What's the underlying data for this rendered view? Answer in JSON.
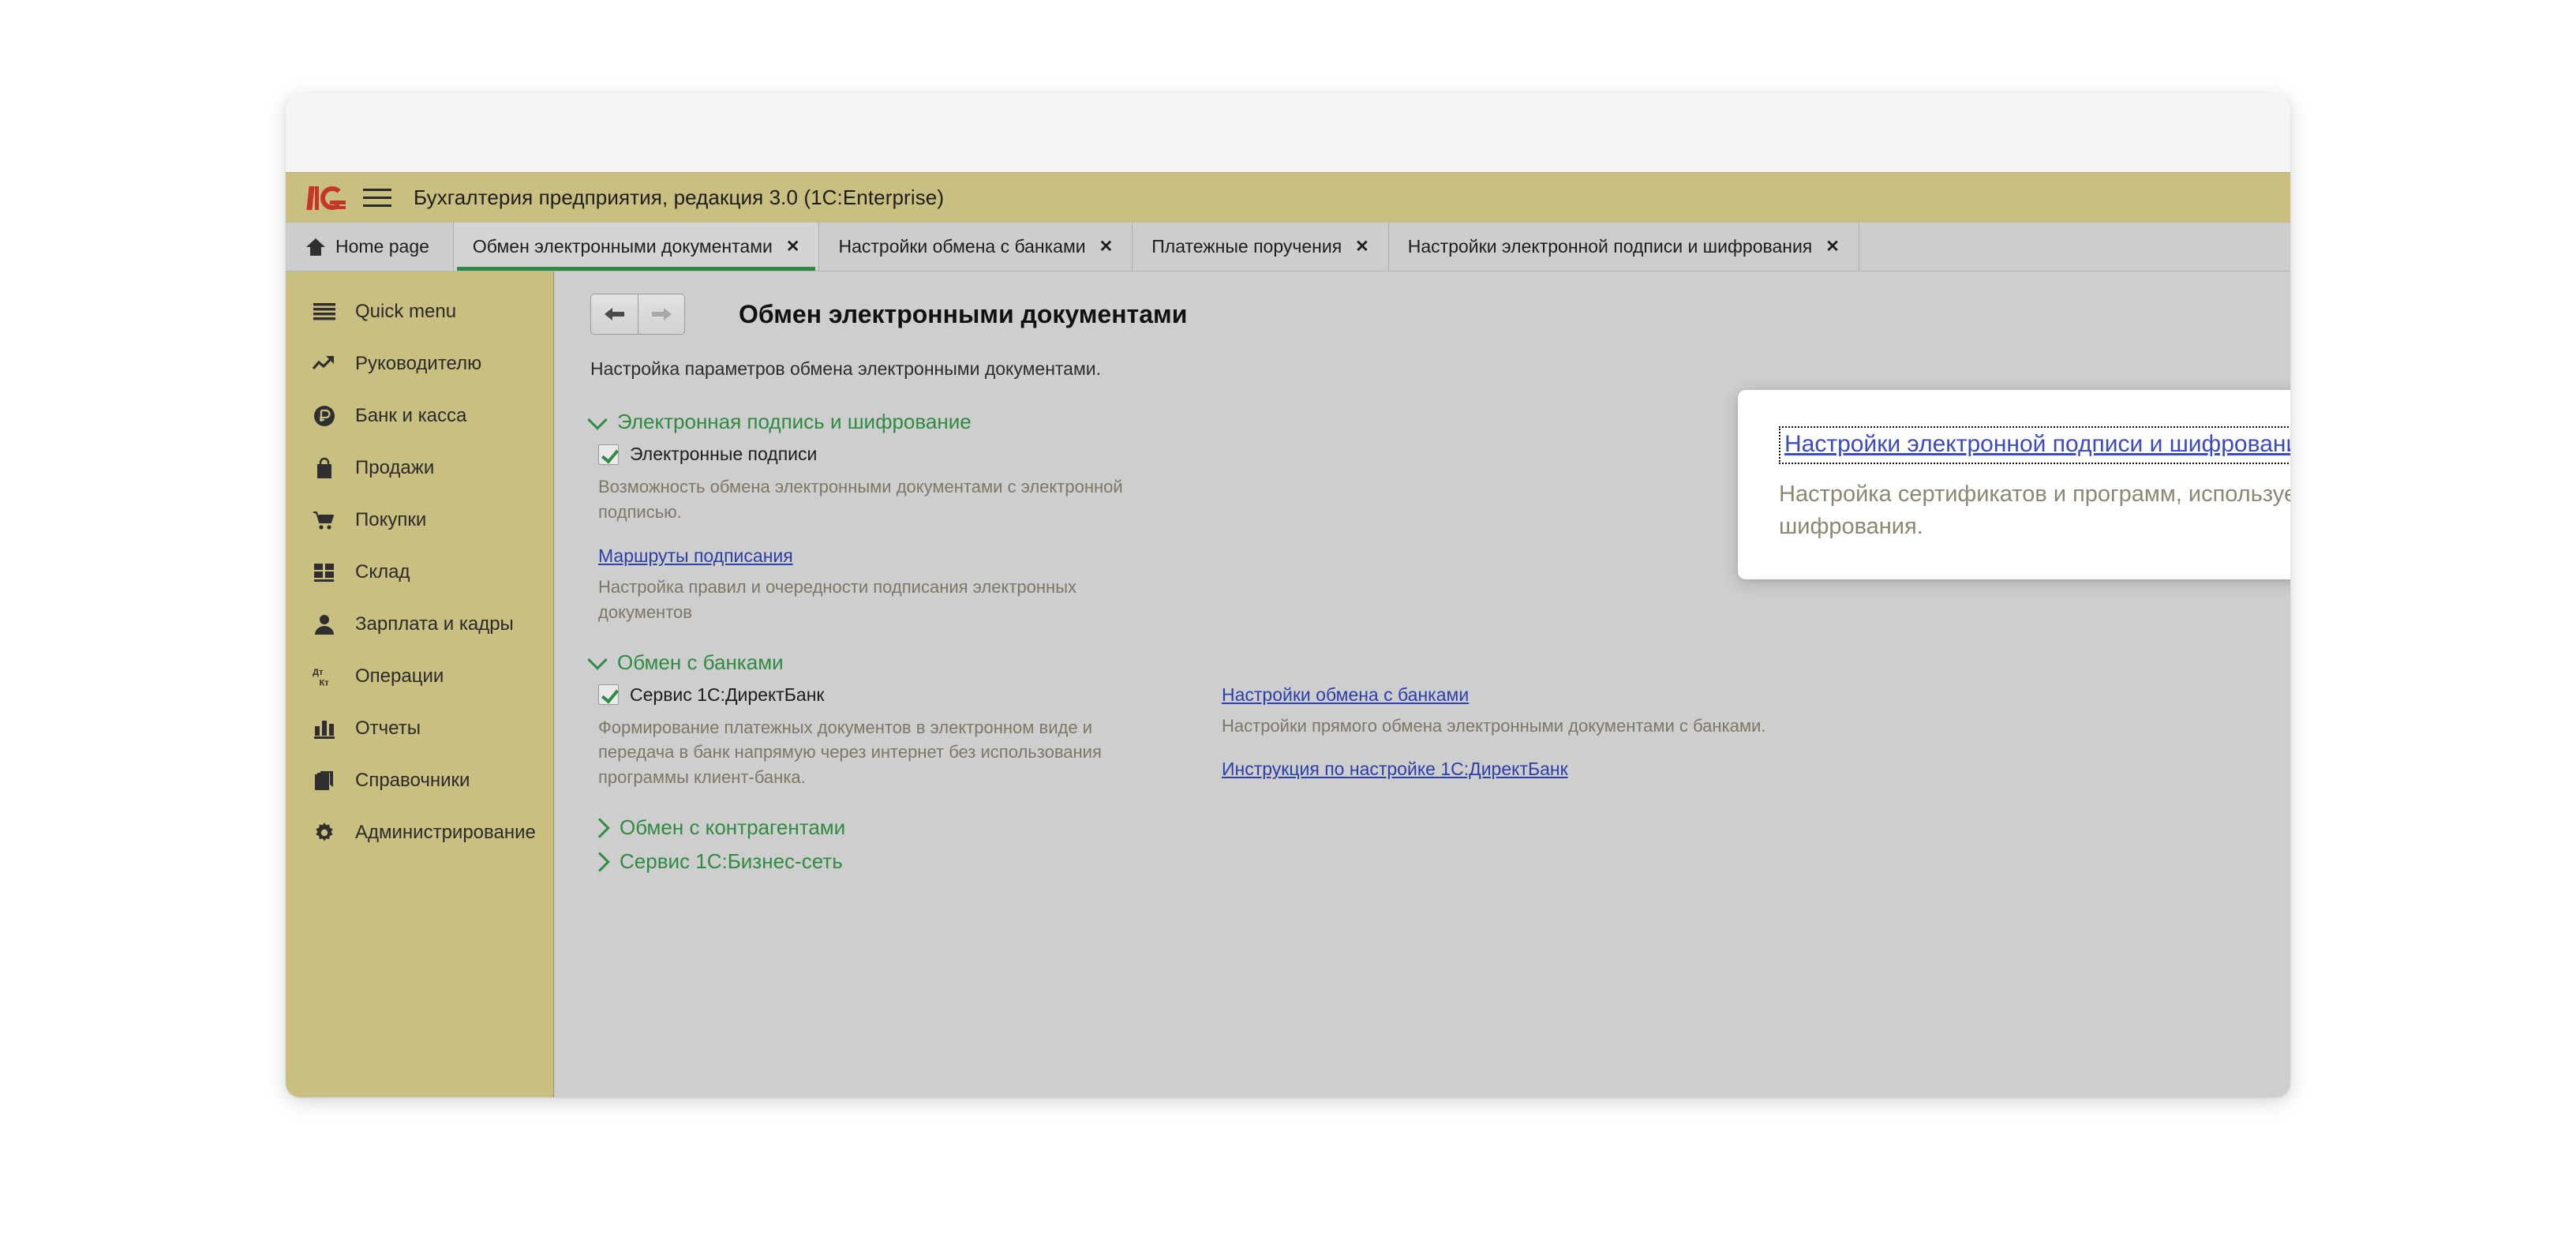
{
  "window": {
    "app_title": "Бухгалтерия предприятия, редакция 3.0  (1C:Enterprise)",
    "logo_name": "1c-logo",
    "burger_name": "main-menu-icon"
  },
  "tabs": [
    {
      "label": "Home page",
      "closable": false,
      "active": false,
      "icon": "home-icon"
    },
    {
      "label": "Обмен электронными документами",
      "closable": true,
      "active": true,
      "close": "✕"
    },
    {
      "label": "Настройки обмена с банками",
      "closable": true,
      "active": false,
      "close": "✕"
    },
    {
      "label": "Платежные поручения",
      "closable": true,
      "active": false,
      "close": "✕"
    },
    {
      "label": "Настройки электронной подписи и шифрования",
      "closable": true,
      "active": false,
      "close": "✕"
    }
  ],
  "sidebar": {
    "items": [
      {
        "label": "Quick menu",
        "icon": "hamburger-icon"
      },
      {
        "label": "Руководителю",
        "icon": "trend-arrow-icon"
      },
      {
        "label": "Банк и касса",
        "icon": "ruble-coin-icon"
      },
      {
        "label": "Продажи",
        "icon": "shopping-bag-icon"
      },
      {
        "label": "Покупки",
        "icon": "shopping-cart-icon"
      },
      {
        "label": "Склад",
        "icon": "warehouse-grid-icon"
      },
      {
        "label": "Зарплата и кадры",
        "icon": "person-icon"
      },
      {
        "label": "Операции",
        "icon": "debit-credit-icon"
      },
      {
        "label": "Отчеты",
        "icon": "bar-chart-icon"
      },
      {
        "label": "Справочники",
        "icon": "books-icon"
      },
      {
        "label": "Администрирование",
        "icon": "gear-icon"
      }
    ]
  },
  "content": {
    "back_icon": "arrow-left-icon",
    "forward_icon": "arrow-right-icon",
    "heading": "Обмен электронными документами",
    "subtitle": "Настройка параметров обмена электронными документами.",
    "sections": [
      {
        "title": "Электронная подпись и шифрование",
        "expanded": true,
        "checkbox_label": "Электронные подписи",
        "checkbox_checked": true,
        "checkbox_desc": "Возможность обмена электронными документами с электронной подписью.",
        "link": "Маршруты подписания",
        "link_desc": "Настройка правил и очередности подписания электронных документов"
      },
      {
        "title": "Обмен с банками",
        "expanded": true,
        "checkbox_label": "Сервис 1С:ДиректБанк",
        "checkbox_checked": true,
        "checkbox_desc": "Формирование платежных документов в электронном виде и передача в банк напрямую через интернет без использования программы клиент-банка.",
        "right_link_1": "Настройки обмена с банками",
        "right_link_1_desc": "Настройки прямого обмена электронными документами с банками.",
        "right_link_2": "Инструкция по настройке 1С:ДиректБанк"
      },
      {
        "title": "Обмен с контрагентами",
        "expanded": false
      },
      {
        "title": "Сервис 1С:Бизнес-сеть",
        "expanded": false
      }
    ]
  },
  "popup": {
    "link": "Настройки электронной подписи и шифрования",
    "description": "Настройка сертификатов и программ, используемых для подписания и шифрования."
  },
  "colors": {
    "brand_khaki": "#c9bf80",
    "accent_green": "#2e8b41",
    "link_blue": "#2b3faa",
    "popup_link_blue": "#3b49c4",
    "content_bg": "#cecece",
    "muted_text": "#7d7766",
    "logo_red": "#c4352c"
  }
}
